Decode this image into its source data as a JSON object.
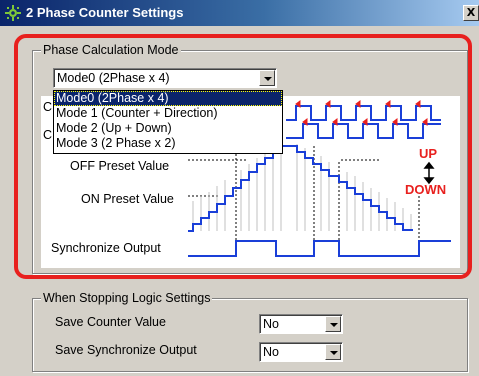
{
  "window": {
    "title": "2 Phase Counter Settings",
    "close_glyph": "X",
    "icon": "gear-icon"
  },
  "phase_calc": {
    "group_label": "Phase Calculation Mode",
    "mode_selected": "Mode0 (2Phase x 4)",
    "mode_options": [
      "Mode0 (2Phase x 4)",
      "Mode 1 (Counter + Direction)",
      "Mode 2 (Up + Down)",
      "Mode 3 (2 Phase x 2)"
    ],
    "diagram": {
      "hidden_label_1": "C",
      "hidden_label_2": "C",
      "off_preset_label": "OFF Preset Value",
      "on_preset_label": "ON Preset Value",
      "sync_output_label": "Synchronize Output",
      "up_label": "UP",
      "down_label": "DOWN"
    }
  },
  "stopping": {
    "group_label": "When Stopping Logic Settings",
    "save_counter_label": "Save Counter Value",
    "save_counter_value": "No",
    "save_sync_label": "Save Synchronize Output",
    "save_sync_value": "No"
  },
  "colors": {
    "titlebar_start": "#0a246a",
    "highlight_frame": "#e8201e",
    "signal_line": "#1a3fd8",
    "arrow_red": "#e8201e"
  }
}
